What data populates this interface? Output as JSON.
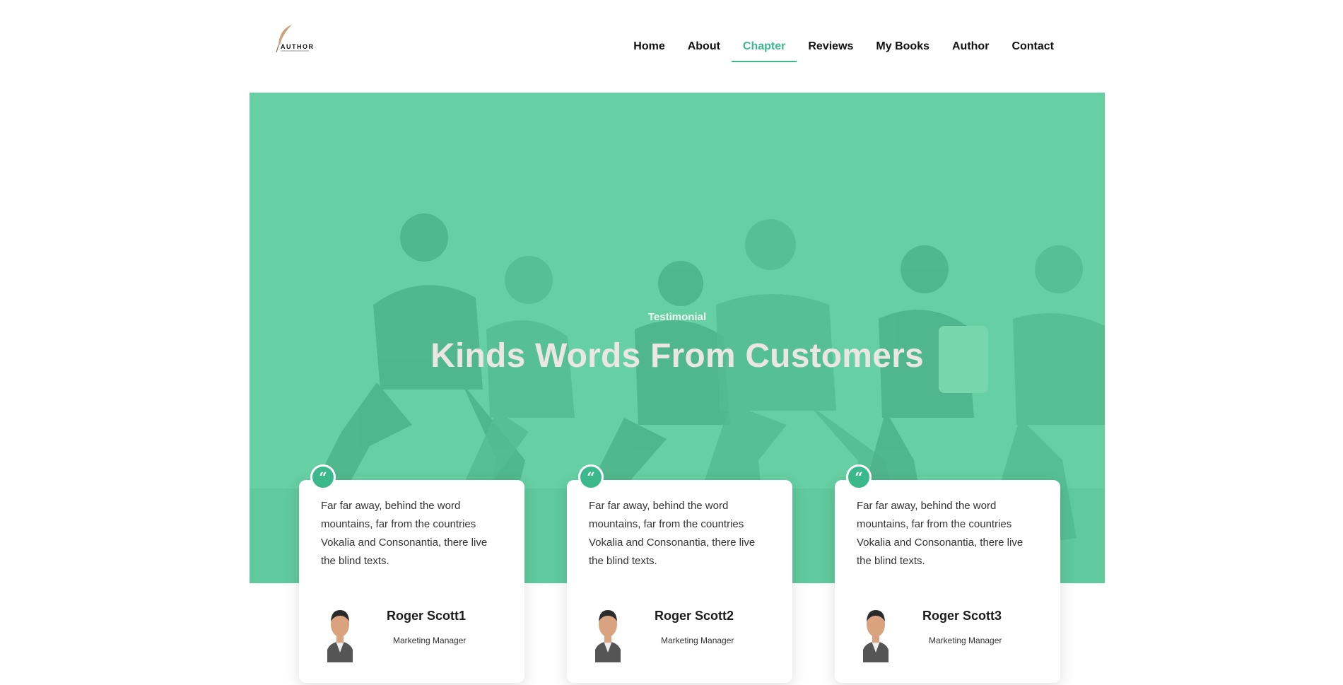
{
  "logo": {
    "text": "AUTHOR"
  },
  "nav": {
    "items": [
      "Home",
      "About",
      "Chapter",
      "Reviews",
      "My Books",
      "Author",
      "Contact"
    ],
    "active": "Chapter"
  },
  "hero": {
    "eyebrow": "Testimonial",
    "title": "Kinds Words From Customers"
  },
  "testimonials": [
    {
      "text": "Far far away, behind the word mountains, far from the countries Vokalia and Consonantia, there live the blind texts.",
      "name": "Roger Scott1",
      "role": "Marketing Manager"
    },
    {
      "text": "Far far away, behind the word mountains, far from the countries Vokalia and Consonantia, there live the blind texts.",
      "name": "Roger Scott2",
      "role": "Marketing Manager"
    },
    {
      "text": "Far far away, behind the word mountains, far from the countries Vokalia and Consonantia, there live the blind texts.",
      "name": "Roger Scott3",
      "role": "Marketing Manager"
    }
  ],
  "icons": {
    "quote": "quote-icon",
    "logo": "feather-icon"
  },
  "colors": {
    "accent": "#3cb98c",
    "hero_overlay": "#66cfa4"
  }
}
